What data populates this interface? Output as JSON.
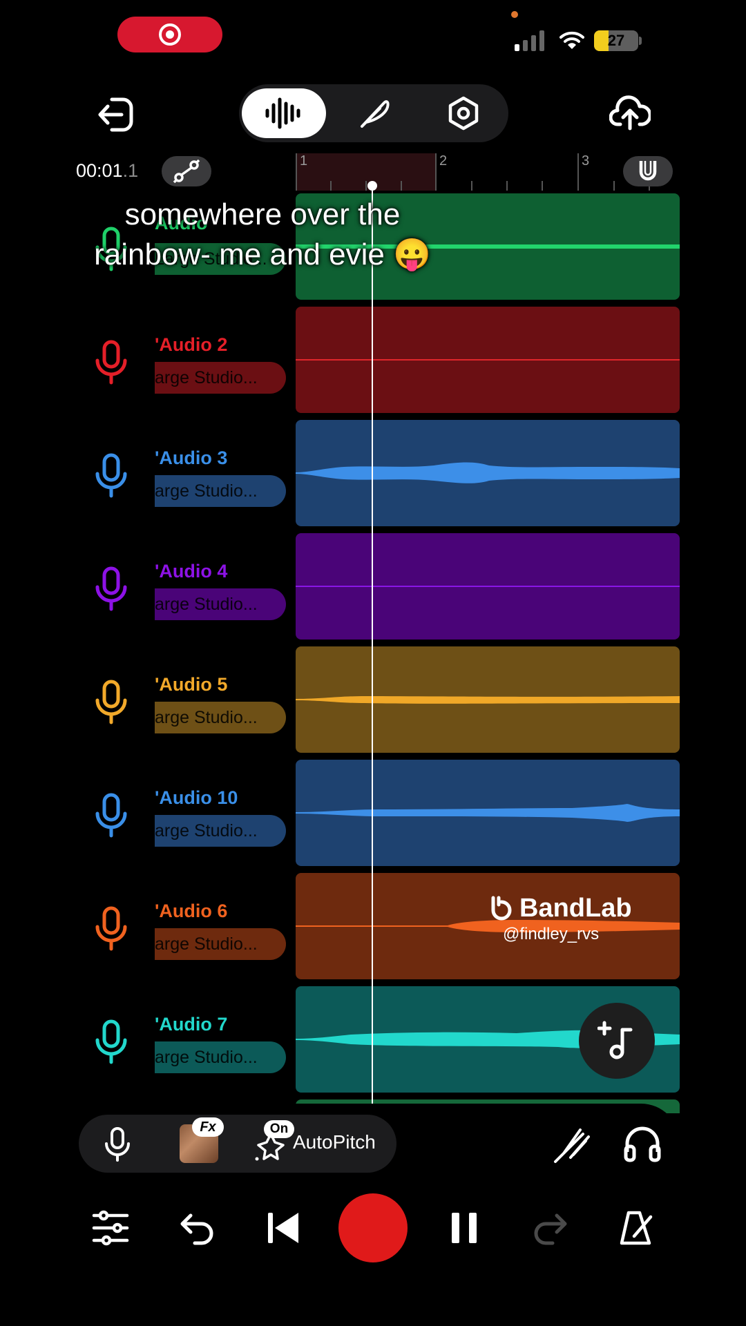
{
  "status_bar": {
    "battery_level": "27"
  },
  "toolbar": {
    "modes": [
      {
        "name": "waveform",
        "active": true
      },
      {
        "name": "feather",
        "active": false
      },
      {
        "name": "settings",
        "active": false
      }
    ]
  },
  "timeline": {
    "time_main": "00:01",
    "time_fraction": ".1",
    "bars": [
      "1",
      "2",
      "3"
    ]
  },
  "tracks": [
    {
      "name": "Audio",
      "preset": "Large Studio...",
      "color": "#1fd069",
      "clip_bg": "#0e6032",
      "line": "#22d46c"
    },
    {
      "name": "'Audio 2",
      "preset": "arge Studio...",
      "color": "#e51f28",
      "clip_bg": "#6b0f13",
      "line": "#e0262b"
    },
    {
      "name": "'Audio 3",
      "preset": "arge Studio...",
      "color": "#3a8fe8",
      "clip_bg": "#1e4270",
      "line": "#3d8fe8"
    },
    {
      "name": "'Audio 4",
      "preset": "arge Studio...",
      "color": "#8d12e6",
      "clip_bg": "#4a0478",
      "line": "#8a16e6"
    },
    {
      "name": "'Audio 5",
      "preset": "arge Studio...",
      "color": "#f2a92a",
      "clip_bg": "#6e5016",
      "line": "#f0a828"
    },
    {
      "name": "'Audio 10",
      "preset": "arge Studio...",
      "color": "#3a8fe8",
      "clip_bg": "#1e4270",
      "line": "#3d8fe8"
    },
    {
      "name": "'Audio 6",
      "preset": "arge Studio...",
      "color": "#f0621f",
      "clip_bg": "#6e2a0e",
      "line": "#f0621f"
    },
    {
      "name": "'Audio 7",
      "preset": "arge Studio...",
      "color": "#22d8cc",
      "clip_bg": "#0c5a58",
      "line": "#22d8cc"
    }
  ],
  "caption": {
    "line1": "somewhere over the",
    "line2": "rainbow- me and evie 😛"
  },
  "watermark": {
    "brand": "BandLab",
    "handle": "@findley_rvs"
  },
  "input_bar": {
    "fx_badge": "Fx",
    "on_badge": "On",
    "autopitch_label": "AutoPitch"
  },
  "transport": {
    "buttons": [
      "mixer",
      "undo",
      "skip-back",
      "record",
      "pause",
      "redo",
      "metronome"
    ]
  }
}
